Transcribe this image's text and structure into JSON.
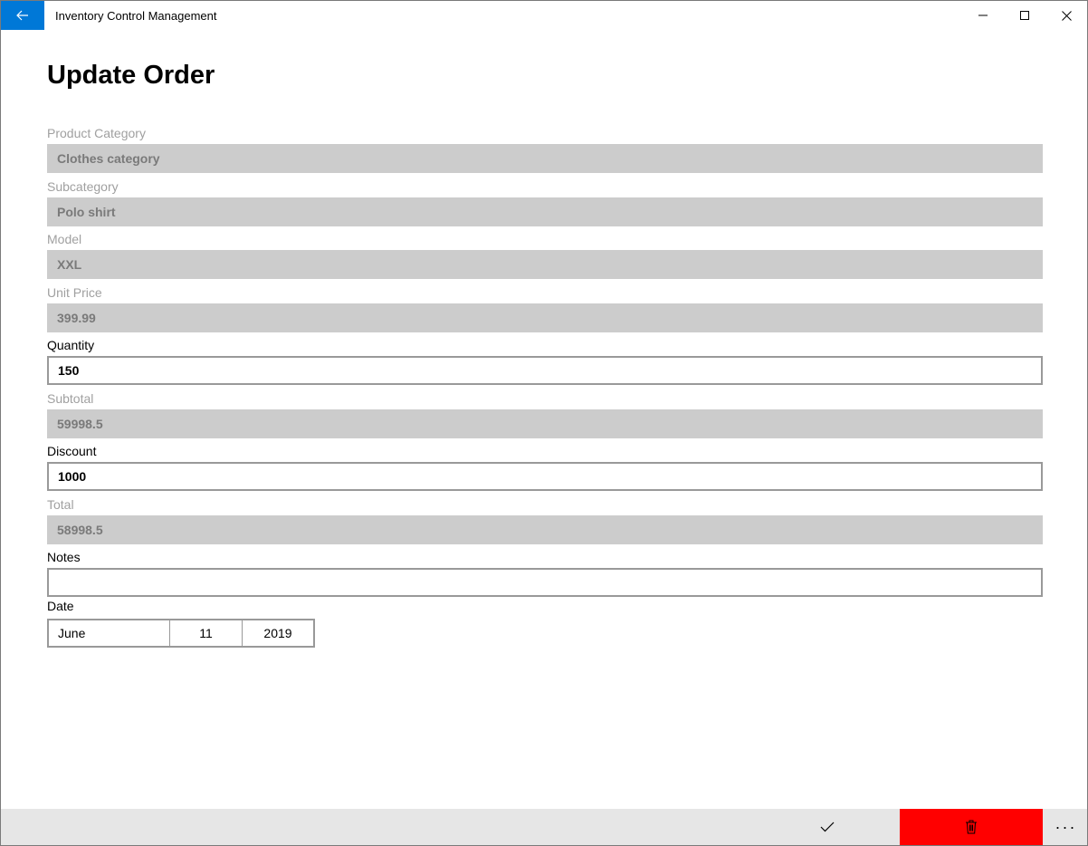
{
  "app": {
    "title": "Inventory Control Management"
  },
  "page": {
    "title": "Update Order"
  },
  "fields": {
    "product_category": {
      "label": "Product Category",
      "value": "Clothes category"
    },
    "subcategory": {
      "label": "Subcategory",
      "value": "Polo shirt"
    },
    "model": {
      "label": "Model",
      "value": "XXL"
    },
    "unit_price": {
      "label": "Unit Price",
      "value": "399.99"
    },
    "quantity": {
      "label": "Quantity",
      "value": "150"
    },
    "subtotal": {
      "label": "Subtotal",
      "value": "59998.5"
    },
    "discount": {
      "label": "Discount",
      "value": "1000"
    },
    "total": {
      "label": "Total",
      "value": "58998.5"
    },
    "notes": {
      "label": "Notes",
      "value": ""
    }
  },
  "date": {
    "label": "Date",
    "month": "June",
    "day": "11",
    "year": "2019"
  },
  "command_bar": {
    "more_label": "···"
  },
  "colors": {
    "accent": "#0078d7",
    "delete": "#ff0000",
    "disabled_bg": "#cccccc",
    "command_bar_bg": "#e6e6e6"
  },
  "icons": {
    "back": "back-arrow-icon",
    "minimize": "minimize-icon",
    "maximize": "maximize-icon",
    "close": "close-icon",
    "accept": "checkmark-icon",
    "delete": "trash-icon",
    "more": "more-icon"
  }
}
